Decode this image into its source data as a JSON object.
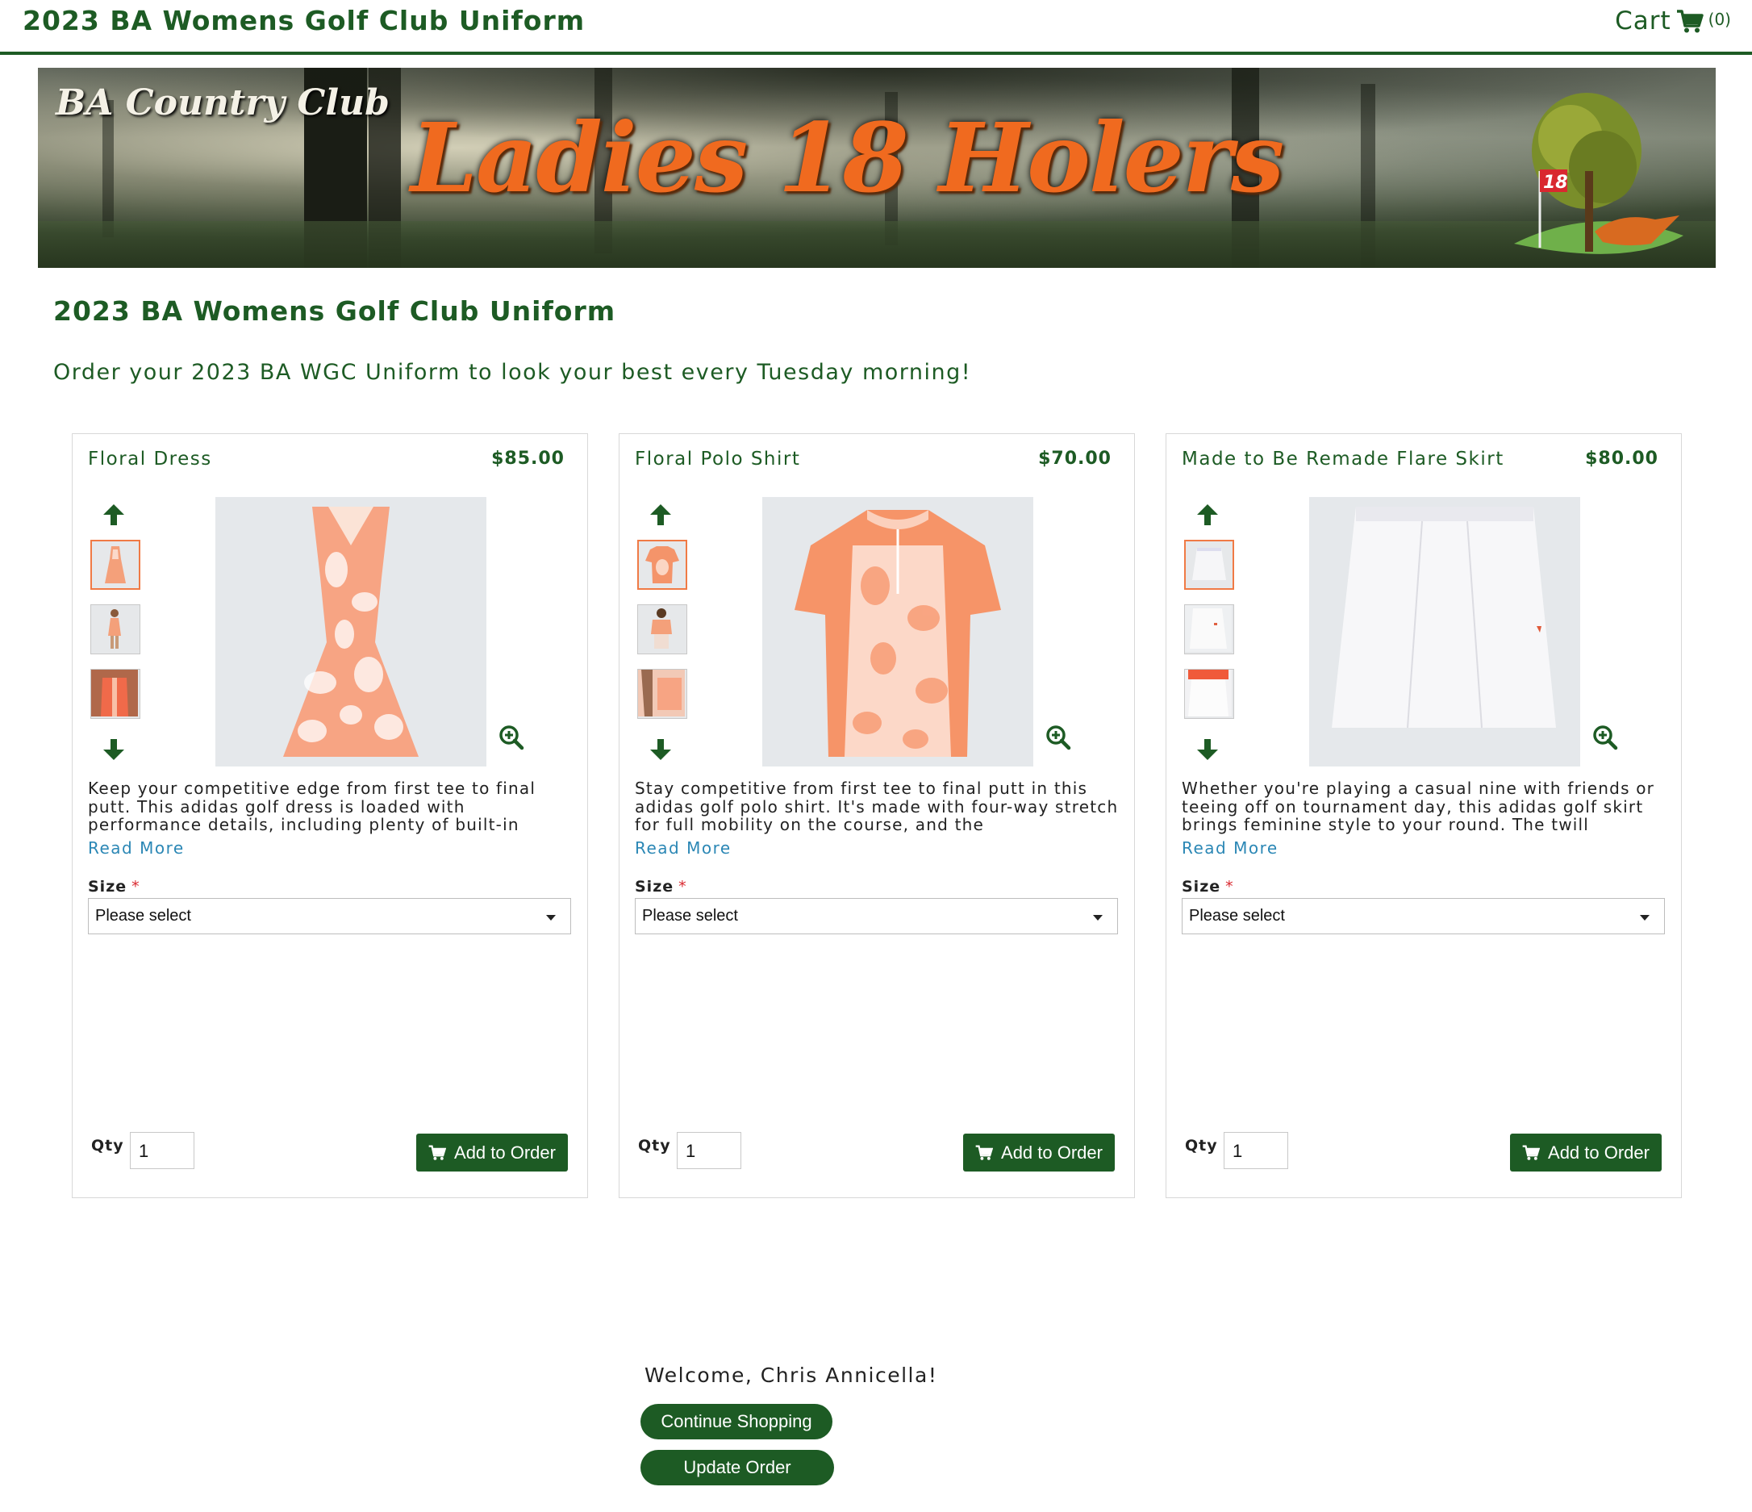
{
  "header": {
    "title": "2023 BA Womens Golf Club Uniform",
    "cart_label": "Cart",
    "cart_count": "(0)"
  },
  "banner": {
    "club_name": "BA Country Club",
    "headline": "Ladies 18 Holers",
    "flag_number": "18"
  },
  "page": {
    "title": "2023 BA Womens Golf Club Uniform",
    "subtitle": "Order your 2023 BA WGC Uniform to look your best every Tuesday morning!"
  },
  "products": [
    {
      "name": "Floral Dress",
      "price": "$85.00",
      "description": "Keep your competitive edge from first tee to final putt. This adidas golf dress is loaded with performance details, including plenty of built-in",
      "read_more": "Read More",
      "size_label": "Size",
      "required_mark": "*",
      "size_value": "Please select",
      "qty_label": "Qty",
      "qty_value": "1",
      "add_label": "Add to Order"
    },
    {
      "name": "Floral Polo Shirt",
      "price": "$70.00",
      "description": "Stay competitive from first tee to final putt in this adidas golf polo shirt. It's made with four-way stretch for full mobility on the course, and the",
      "read_more": "Read More",
      "size_label": "Size",
      "required_mark": "*",
      "size_value": "Please select",
      "qty_label": "Qty",
      "qty_value": "1",
      "add_label": "Add to Order"
    },
    {
      "name": "Made to Be Remade Flare Skirt",
      "price": "$80.00",
      "description": "Whether you're playing a casual nine with friends or teeing off on tournament day, this adidas golf skirt brings feminine style to your round. The twill",
      "read_more": "Read More",
      "size_label": "Size",
      "required_mark": "*",
      "size_value": "Please select",
      "qty_label": "Qty",
      "qty_value": "1",
      "add_label": "Add to Order"
    }
  ],
  "footer": {
    "welcome": "Welcome, Chris Annicella!",
    "continue_label": "Continue Shopping",
    "update_label": "Update Order"
  },
  "colors": {
    "brand_green": "#1d5b24",
    "accent_orange": "#f07a45",
    "link_blue": "#2b87b5",
    "required_red": "#d9282f"
  },
  "icons": [
    "cart-icon",
    "arrow-up-icon",
    "arrow-down-icon",
    "zoom-in-icon"
  ]
}
